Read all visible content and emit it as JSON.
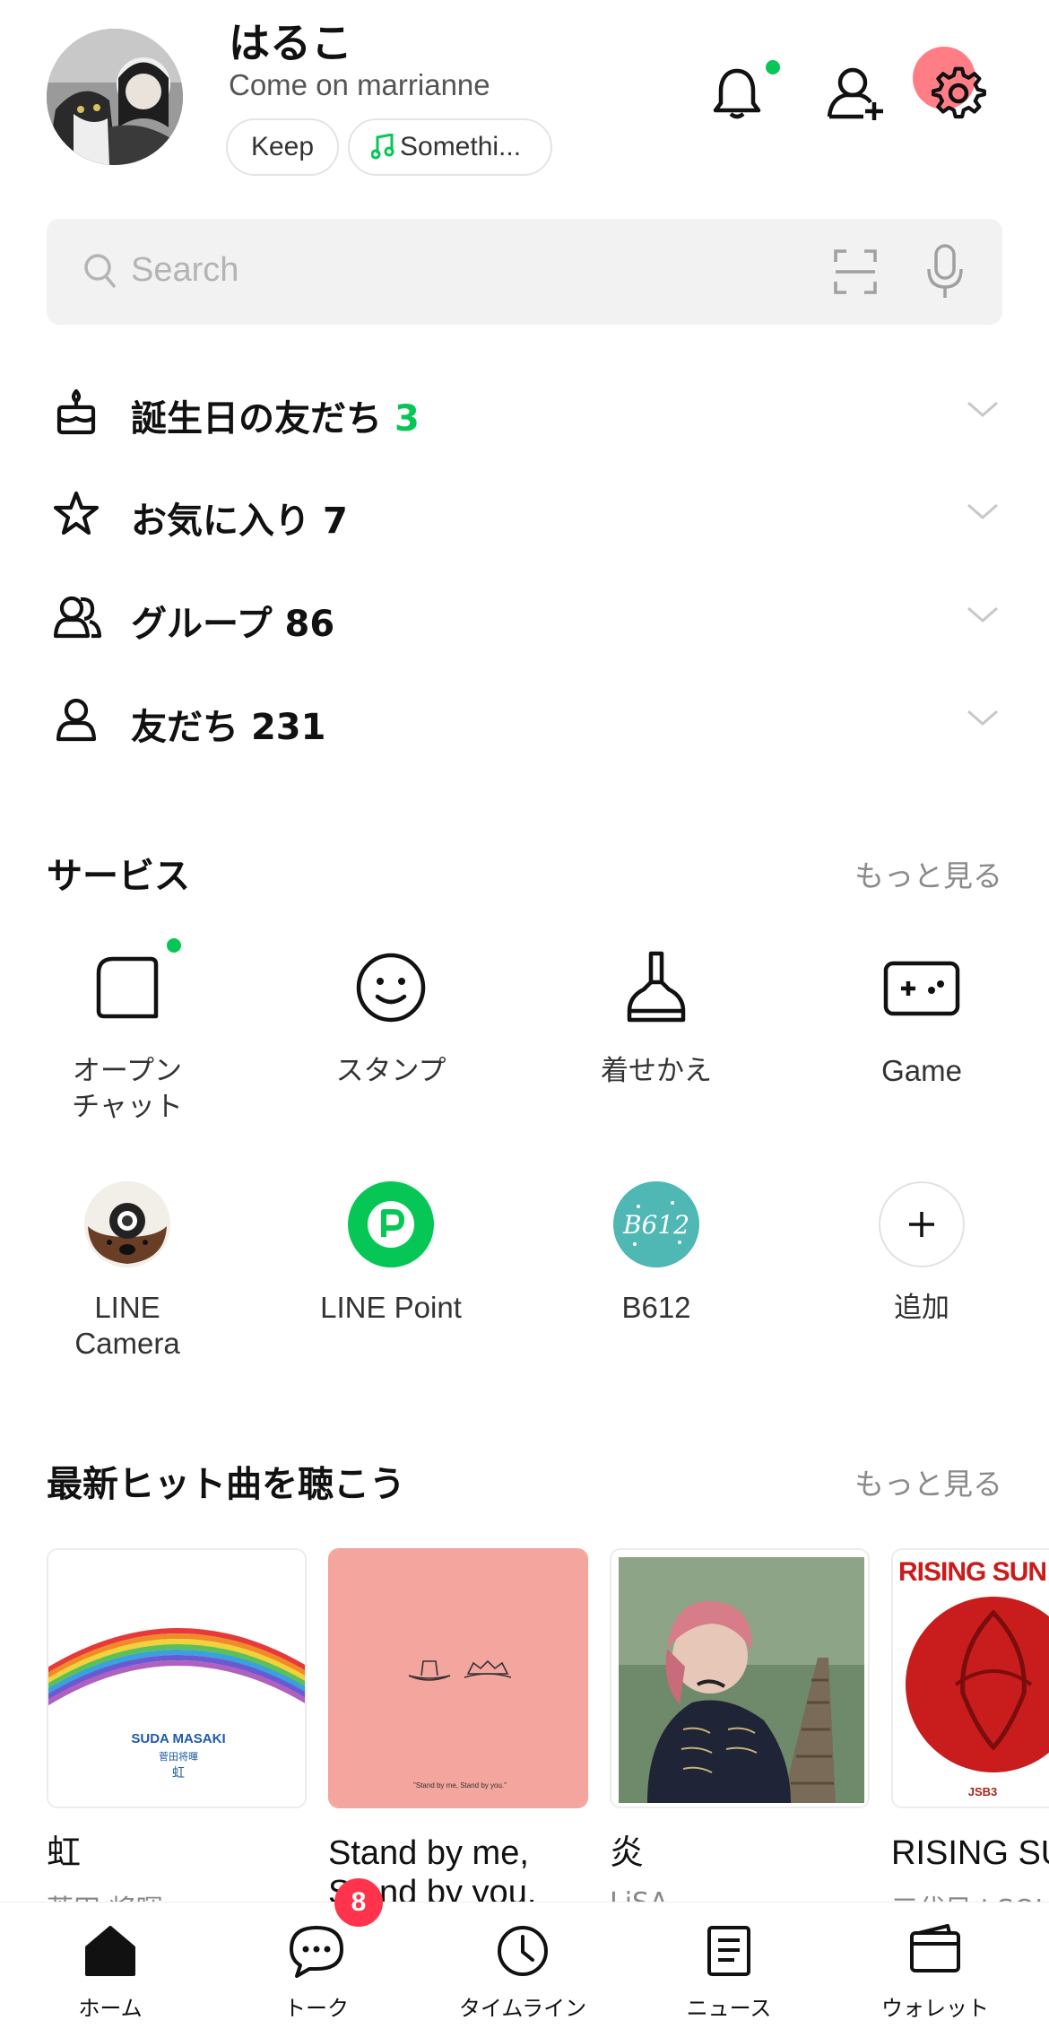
{
  "profile": {
    "name": "はるこ",
    "status_message": "Come on marrianne",
    "keep_label": "Keep",
    "bgm_label": "Somethi..."
  },
  "header": {
    "icons": [
      "bell-icon",
      "add-friend-icon",
      "settings-icon"
    ],
    "notification_dot": true
  },
  "search": {
    "placeholder": "Search"
  },
  "friend_sections": [
    {
      "icon": "cake-icon",
      "label": "誕生日の友だち",
      "count": "3",
      "count_color": "#06c755"
    },
    {
      "icon": "star-icon",
      "label": "お気に入り",
      "count": "7"
    },
    {
      "icon": "group-icon",
      "label": "グループ",
      "count": "86"
    },
    {
      "icon": "friend-icon",
      "label": "友だち",
      "count": "231"
    }
  ],
  "services": {
    "title": "サービス",
    "more": "もっと見る",
    "items": [
      {
        "label_line1": "オープン",
        "label_line2": "チャット",
        "icon": "open-chat-icon",
        "new_dot": true
      },
      {
        "label_line1": "スタンプ",
        "icon": "sticker-icon"
      },
      {
        "label_line1": "着せかえ",
        "icon": "theme-brush-icon"
      },
      {
        "label_line1": "Game",
        "icon": "game-controller-icon"
      },
      {
        "label_line1": "LINE",
        "label_line2": "Camera",
        "icon": "line-camera-icon"
      },
      {
        "label_line1": "LINE Point",
        "icon": "line-point-icon"
      },
      {
        "label_line1": "B612",
        "icon": "b612-icon"
      },
      {
        "label_line1": "追加",
        "icon": "plus-icon"
      }
    ]
  },
  "music": {
    "title": "最新ヒット曲を聴こう",
    "more": "もっと見る",
    "tracks": [
      {
        "title": "虹",
        "artist": "菅田 将暉",
        "cover_text_1": "SUDA MASAKI",
        "cover_text_2": "菅田将暉",
        "cover_text_3": "虹"
      },
      {
        "title_line1": "Stand by me,",
        "title_line2": "Stand by you.",
        "cover_text": "\"Stand by me, Stand by you.\""
      },
      {
        "title": "炎",
        "artist": "LiSA"
      },
      {
        "title": "RISING SUN TO THE SKY",
        "artist": "三代目 J SOUL BROTHERS",
        "cover_text_1": "RISING SUN TO T",
        "cover_text_2": "JSB3"
      }
    ]
  },
  "bottom_nav": [
    {
      "label": "ホーム",
      "icon": "home-icon",
      "active": true
    },
    {
      "label": "トーク",
      "icon": "chat-icon",
      "badge": "8"
    },
    {
      "label": "タイムライン",
      "icon": "clock-icon"
    },
    {
      "label": "ニュース",
      "icon": "news-icon"
    },
    {
      "label": "ウォレット",
      "icon": "wallet-icon"
    }
  ],
  "colors": {
    "accent": "#06c755",
    "badge": "#ff334b"
  }
}
